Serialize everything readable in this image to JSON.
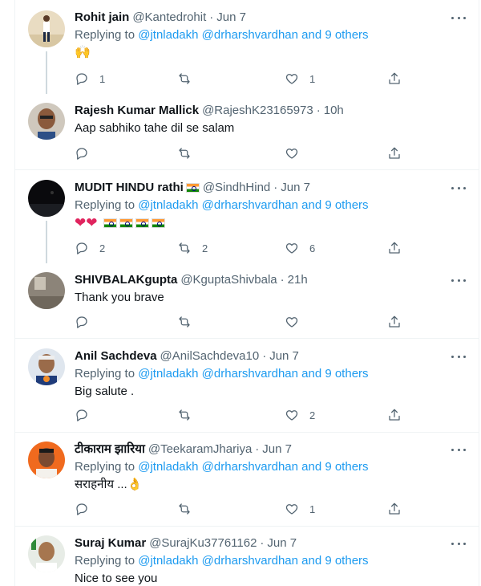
{
  "replying_prefix": "Replying to",
  "and_others": "and 9 others",
  "tweets": [
    {
      "name": "Rohit jain",
      "handle": "@Kantedrohit",
      "time": "Jun 7",
      "replying": [
        "@jtnladakh",
        "@drharshvardhan"
      ],
      "text": "🙌",
      "replies": "1",
      "retweets": "",
      "likes": "1"
    },
    {
      "name": "Rajesh Kumar Mallick",
      "handle": "@RajeshK23165973",
      "time": "10h",
      "text": "Aap sabhiko tahe dil se salam",
      "replies": "",
      "retweets": "",
      "likes": ""
    },
    {
      "name": "MUDIT HINDU rathi",
      "handle": "@SindhHind",
      "time": "Jun 7",
      "replying": [
        "@jtnladakh",
        "@drharshvardhan"
      ],
      "text": "❤❤",
      "replies": "2",
      "retweets": "2",
      "likes": "6"
    },
    {
      "name": "SHIVBALAKgupta",
      "handle": "@KguptaShivbala",
      "time": "21h",
      "text": "Thank you brave",
      "replies": "",
      "retweets": "",
      "likes": ""
    },
    {
      "name": "Anil Sachdeva",
      "handle": "@AnilSachdeva10",
      "time": "Jun 7",
      "replying": [
        "@jtnladakh",
        "@drharshvardhan"
      ],
      "text": "Big salute .",
      "replies": "",
      "retweets": "",
      "likes": "2"
    },
    {
      "name": "टीकाराम झारिया",
      "handle": "@TeekaramJhariya",
      "time": "Jun 7",
      "replying": [
        "@jtnladakh",
        "@drharshvardhan"
      ],
      "text": "सराहनीय ...👌",
      "replies": "",
      "retweets": "",
      "likes": "1"
    },
    {
      "name": "Suraj Kumar",
      "handle": "@SurajKu37761162",
      "time": "Jun 7",
      "replying": [
        "@jtnladakh",
        "@drharshvardhan"
      ],
      "text": "Nice to see you"
    }
  ],
  "icons": {
    "reply": "reply-icon",
    "retweet": "retweet-icon",
    "like": "heart-icon",
    "share": "share-icon",
    "more": "more-icon"
  },
  "colors": {
    "link": "#1d9bf0",
    "muted": "#536471",
    "thread_line": "#cfd9de",
    "heart": "#e0245e"
  }
}
